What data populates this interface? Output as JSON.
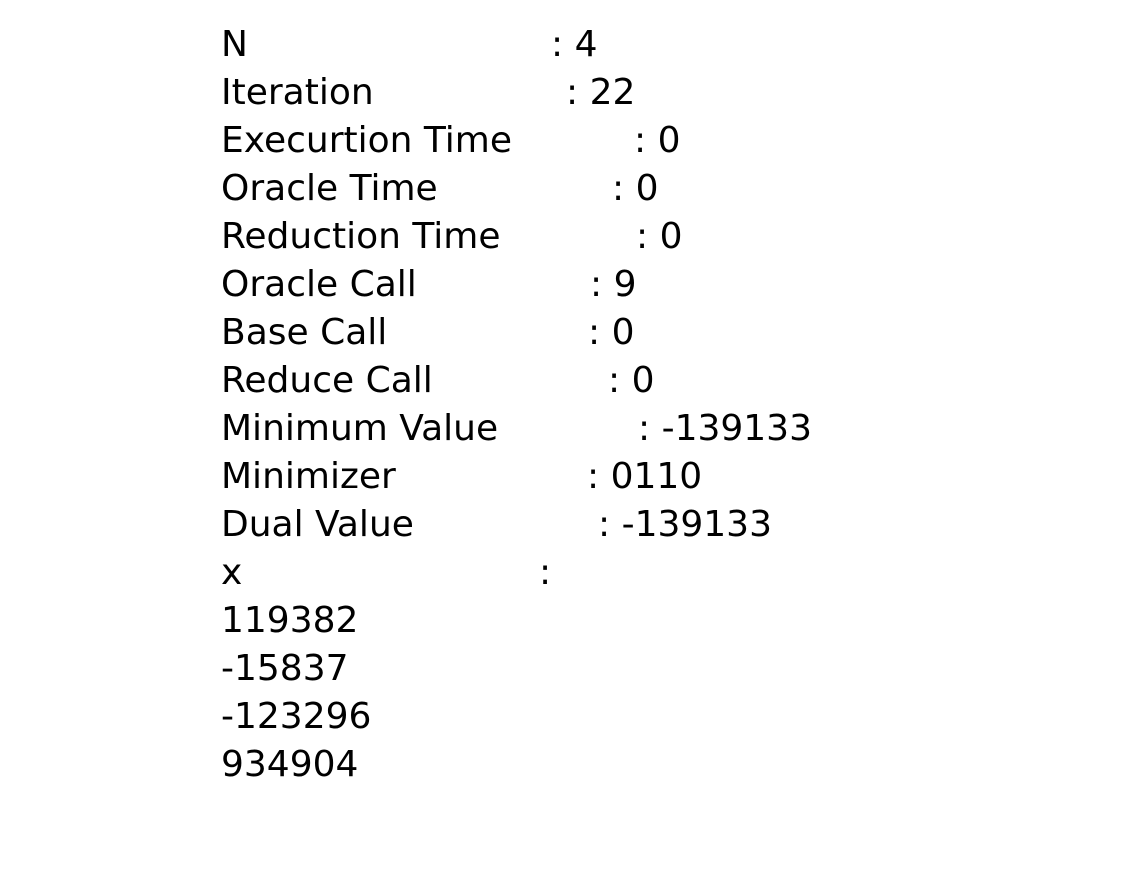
{
  "results": [
    {
      "label": "N",
      "value": ": 4"
    },
    {
      "label": "Iteration",
      "value": ": 22"
    },
    {
      "label": "Execurtion Time",
      "value": ": 0"
    },
    {
      "label": "Oracle Time",
      "value": ": 0"
    },
    {
      "label": "Reduction Time",
      "value": ": 0"
    },
    {
      "label": "Oracle Call",
      "value": ": 9"
    },
    {
      "label": "Base Call",
      "value": ": 0"
    },
    {
      "label": "Reduce Call",
      "value": ": 0"
    },
    {
      "label": "Minimum Value",
      "value": ": -139133"
    },
    {
      "label": "Minimizer",
      "value": ": 0110"
    },
    {
      "label": "Dual Value",
      "value": ": -139133"
    },
    {
      "label": "x",
      "value": ":"
    }
  ],
  "x_values": [
    "119382",
    "-15837",
    "-123296",
    "934904"
  ]
}
